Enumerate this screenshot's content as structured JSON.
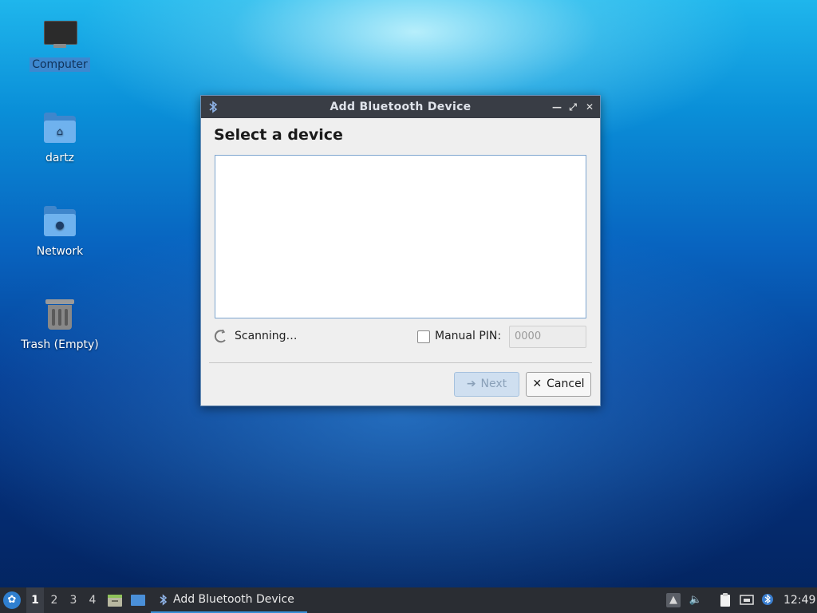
{
  "desktop": {
    "icons": [
      {
        "label": "Computer",
        "icon": "computer-icon",
        "selected": true
      },
      {
        "label": "dartz",
        "icon": "home-folder-icon"
      },
      {
        "label": "Network",
        "icon": "network-folder-icon"
      },
      {
        "label": "Trash (Empty)",
        "icon": "trash-icon"
      }
    ]
  },
  "dialog": {
    "title": "Add Bluetooth Device",
    "heading": "Select a device",
    "devices": [],
    "status": "Scanning…",
    "manual_pin_label": "Manual PIN:",
    "manual_pin_checked": false,
    "pin_placeholder": "0000",
    "next_label": "Next",
    "next_enabled": false,
    "cancel_label": "Cancel",
    "icons": {
      "title": "bluetooth-icon",
      "minimize": "minimize-icon",
      "maximize": "maximize-icon",
      "close": "close-icon",
      "next": "arrow-right-icon",
      "cancel": "x-icon",
      "spinner": "spinner-icon"
    }
  },
  "taskbar": {
    "workspaces": [
      "1",
      "2",
      "3",
      "4"
    ],
    "active_workspace": "1",
    "task_label": "Add Bluetooth Device",
    "clock": "12:49",
    "tray_icons": [
      "eject-icon",
      "volume-icon",
      "clipboard-icon",
      "network-icon",
      "bluetooth-tray-icon"
    ]
  }
}
